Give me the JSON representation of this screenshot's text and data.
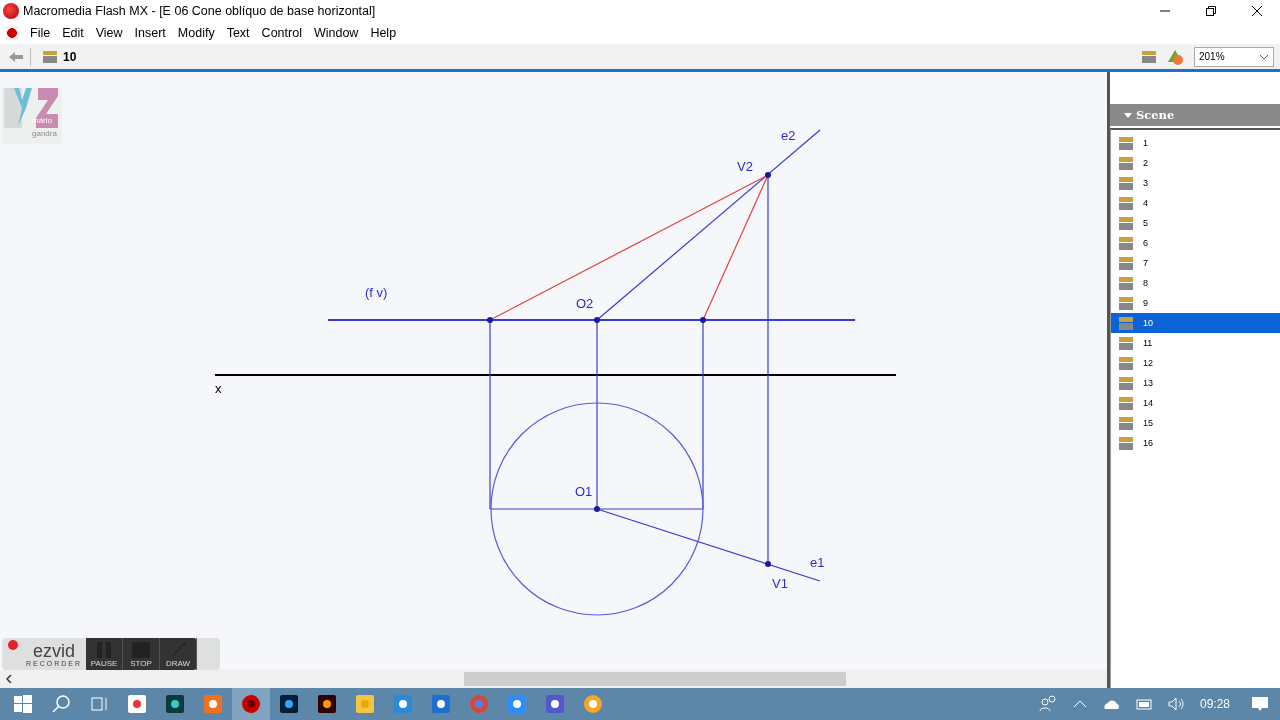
{
  "window": {
    "title": "Macromedia Flash MX - [E 06 Cone oblíquo de base horizontal]"
  },
  "menu": [
    "File",
    "Edit",
    "View",
    "Insert",
    "Modify",
    "Text",
    "Control",
    "Window",
    "Help"
  ],
  "toolbar": {
    "scene": "10",
    "zoom": "201%"
  },
  "stage": {
    "logo": [
      "mário",
      "gandra"
    ],
    "labels": [
      "e2",
      "V2",
      "(f v)",
      "O2",
      "x",
      "O1",
      "e1",
      "V1"
    ]
  },
  "panel": {
    "title": "Scene",
    "scenes": [
      {
        "label": "1",
        "selected": false
      },
      {
        "label": "2",
        "selected": false
      },
      {
        "label": "3",
        "selected": false
      },
      {
        "label": "4",
        "selected": false
      },
      {
        "label": "5",
        "selected": false
      },
      {
        "label": "6",
        "selected": false
      },
      {
        "label": "7",
        "selected": false
      },
      {
        "label": "8",
        "selected": false
      },
      {
        "label": "9",
        "selected": false
      },
      {
        "label": "10",
        "selected": true
      },
      {
        "label": "11",
        "selected": false
      },
      {
        "label": "12",
        "selected": false
      },
      {
        "label": "13",
        "selected": false
      },
      {
        "label": "14",
        "selected": false
      },
      {
        "label": "15",
        "selected": false
      },
      {
        "label": "16",
        "selected": false
      }
    ]
  },
  "recorder": {
    "brand": "ezvid",
    "sub": "RECORDER",
    "buttons": [
      "PAUSE",
      "STOP",
      "DRAW"
    ]
  },
  "taskbar": {
    "time": "09:28"
  }
}
